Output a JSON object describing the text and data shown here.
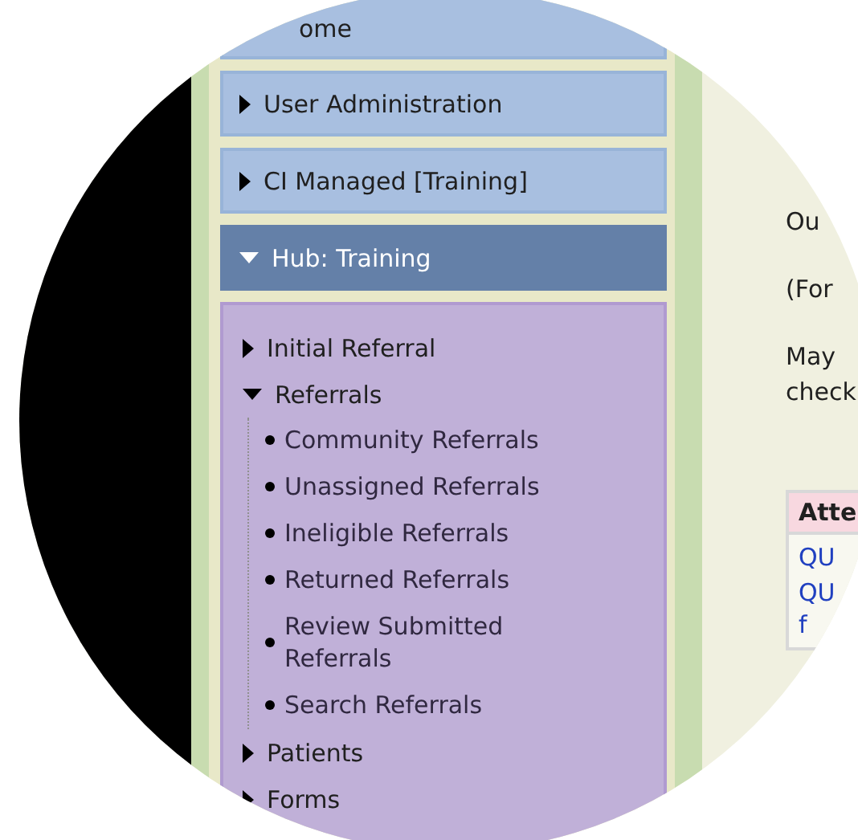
{
  "sidebar": {
    "home": {
      "label": "ome"
    },
    "sections": [
      {
        "label": "User Administration",
        "expanded": false
      },
      {
        "label": "CI Managed [Training]",
        "expanded": false
      },
      {
        "label": "Hub: Training",
        "expanded": true,
        "items": [
          {
            "label": "Initial Referral",
            "expanded": false
          },
          {
            "label": "Referrals",
            "expanded": true,
            "children": [
              {
                "label": "Community Referrals"
              },
              {
                "label": "Unassigned Referrals"
              },
              {
                "label": "Ineligible Referrals"
              },
              {
                "label": "Returned Referrals"
              },
              {
                "label": "Review Submitted Referrals"
              },
              {
                "label": "Search Referrals"
              }
            ]
          },
          {
            "label": "Patients",
            "expanded": false
          },
          {
            "label": "Forms",
            "expanded": false
          }
        ]
      }
    ]
  },
  "content": {
    "paragraphs": [
      [
        "Ou"
      ],
      [
        "(For"
      ],
      [
        "May",
        "check"
      ]
    ],
    "panel": {
      "header": "Atte",
      "links": [
        [
          "QU"
        ],
        [
          "QU",
          "f"
        ]
      ]
    }
  }
}
